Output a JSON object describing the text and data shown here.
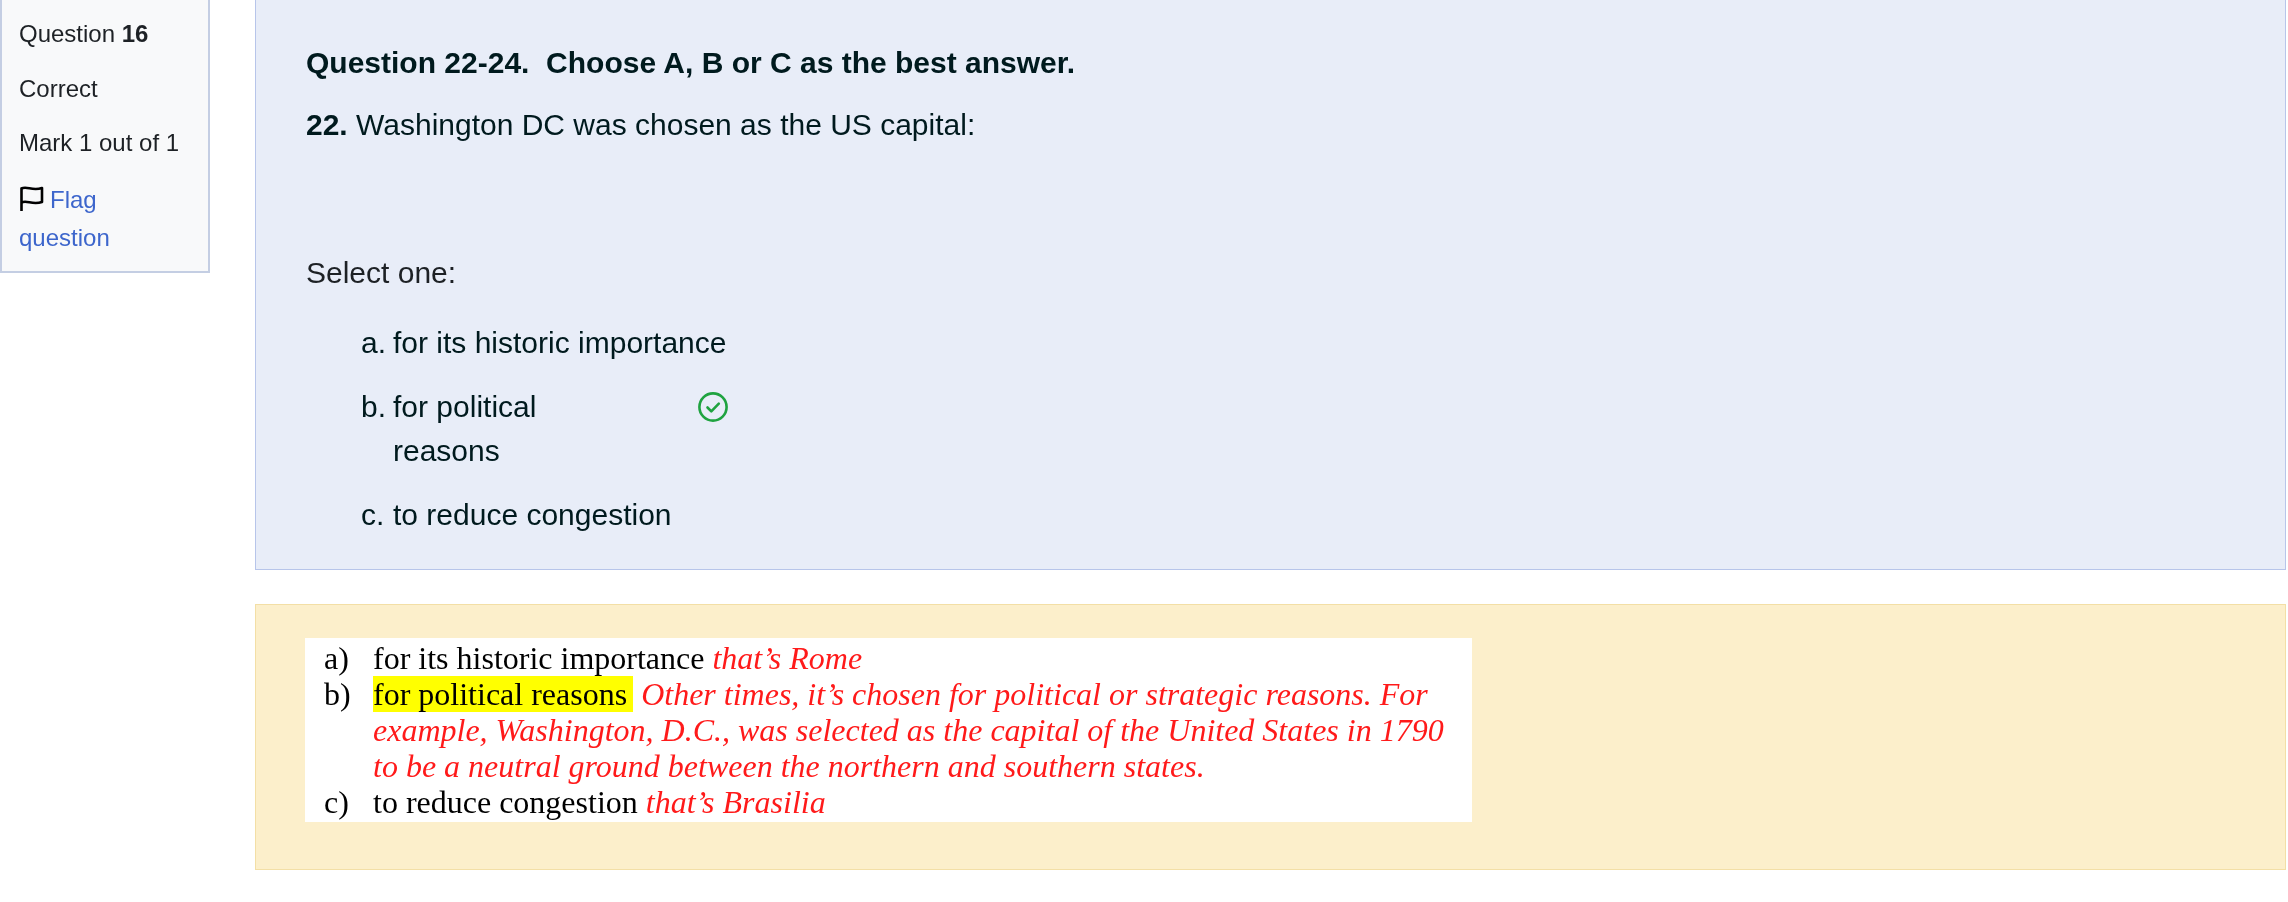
{
  "sidebar": {
    "question_label": "Question **16**",
    "status": "Correct",
    "mark": "Mark 1 out of 1",
    "flag_link": "Flag question",
    "flagged": false
  },
  "question": {
    "heading": "Question 22-24.  Choose A, B or C as the best answer.",
    "text": "**22.** Washington DC was chosen as the US capital:",
    "prompt": "Select one:",
    "options": [
      {
        "letter": "a.",
        "text": "for its historic importance",
        "correct": false
      },
      {
        "letter": "b.",
        "text": "for political reasons",
        "correct": true
      },
      {
        "letter": "c.",
        "text": "to reduce congestion",
        "correct": false
      }
    ]
  },
  "feedback": {
    "items": [
      {
        "marker": "a)",
        "answer": "for its historic importance",
        "highlighted": false,
        "note": "that’s Rome"
      },
      {
        "marker": "b)",
        "answer": "for political reasons",
        "highlighted": true,
        "note": "Other times, it’s chosen for political or strategic reasons. For example, Washington, D.C., was selected as the capital of the United States in 1790 to be a neutral ground between the northern and southern states."
      },
      {
        "marker": "c)",
        "answer": "to reduce congestion",
        "highlighted": false,
        "note": "that’s Brasilia"
      }
    ]
  }
}
